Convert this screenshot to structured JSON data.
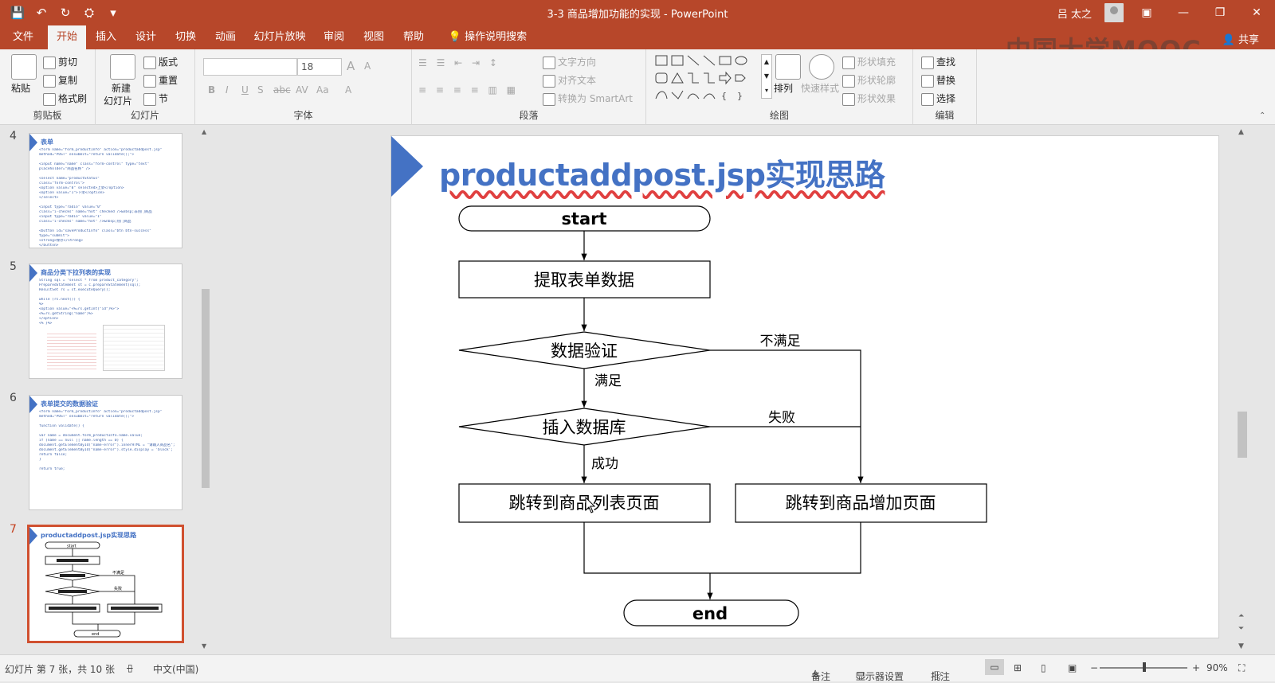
{
  "window": {
    "title": "3-3 商品增加功能的实现  -  PowerPoint",
    "user": "吕 太之",
    "controls": {
      "ribbon_opts": "▣",
      "minimize": "—",
      "restore": "❐",
      "close": "✕"
    }
  },
  "qat": {
    "save": "💾",
    "undo": "↶",
    "redo": "↻",
    "present": "⛭",
    "more": "▾"
  },
  "menu": {
    "tabs": [
      "文件",
      "开始",
      "插入",
      "设计",
      "切换",
      "动画",
      "幻灯片放映",
      "审阅",
      "视图",
      "帮助"
    ],
    "active": "开始",
    "tell_me": "操作说明搜索",
    "share": "共享"
  },
  "watermark": "中国大学MOOC",
  "ribbon": {
    "clipboard": {
      "label": "剪贴板",
      "paste": "粘贴",
      "cut": "剪切",
      "copy": "复制",
      "painter": "格式刷"
    },
    "slides": {
      "label": "幻灯片",
      "new_slide": "新建",
      "new_slide2": "幻灯片",
      "layout": "版式",
      "reset": "重置",
      "section": "节"
    },
    "font": {
      "label": "字体",
      "font_name": "",
      "font_size": "18",
      "b": "B",
      "i": "I",
      "u": "U",
      "s": "S",
      "abc": "abc",
      "av": "AV",
      "aa": "Aa",
      "a": "A",
      "grow": "A",
      "shrink": "A"
    },
    "paragraph": {
      "label": "段落",
      "text_dir": "文字方向",
      "align_text": "对齐文本",
      "smartart": "转换为 SmartArt"
    },
    "drawing": {
      "label": "绘图",
      "arrange": "排列",
      "quick_styles": "快速样式",
      "fill": "形状填充",
      "outline": "形状轮廓",
      "effects": "形状效果"
    },
    "editing": {
      "label": "编辑",
      "find": "查找",
      "replace": "替换",
      "select": "选择"
    }
  },
  "thumbnails": [
    {
      "num": "4",
      "title": "表单",
      "lines": [
        "<form name=\"form_productInfo\" action=\"productaddpost.jsp\"",
        "method=\"POST\" onsubmit=\"return validate();\">",
        "",
        "<input name=\"name\" class=\"form-control\" type=\"text\"",
        "placeholder=\"商品名称\" />",
        "",
        "<select name=\"productStatus\"",
        "class=\"form-control\">",
        "<option value=\"0\" selected>上架</option>",
        "<option value=\"1\">下架</option>",
        "</select>",
        "",
        "<input type=\"radio\" value=\"0\"",
        "class=\"i-checks\" name=\"hot\" checked />&nbsp;非热门商品",
        "<input type=\"radio\" value=\"1\"",
        "class=\"i-checks\" name=\"hot\" />&nbsp;热门商品",
        "",
        "<button id=\"saveProductInfo\" class=\"btn btn-success\"",
        "type=\"submit\">",
        "<strong>保存</strong>",
        "</button>"
      ]
    },
    {
      "num": "5",
      "title": "商品分类下拉列表的实现",
      "lines": [
        "String sql = \"select * from product_category\";",
        "PreparedStatement st = c.prepareStatement(sql);",
        "ResultSet rs = st.executeQuery();",
        "",
        "while (rs.next()) {",
        "%>",
        "<option value=\"<%=rs.getInt(\"id\")%>\">",
        "  <%=rs.getString(\"name\")%>",
        "</option>",
        "<% }%>"
      ]
    },
    {
      "num": "6",
      "title": "表单提交的数据验证",
      "lines": [
        "<form name=\"form_productInfo\" action=\"productaddpost.jsp\"",
        "method=\"POST\" onsubmit=\"return validate();\">",
        "",
        "function validate() {",
        "",
        "var name = document.form_productInfo.name.value;",
        "if (name == null || name.length == 0) {",
        "  document.getElementById(\"name-error\").innerHTML = \"请输入商品名\";",
        "  document.getElementById(\"name-error\").style.display = 'block';",
        "return false;",
        "}",
        "",
        "return true;"
      ]
    },
    {
      "num": "7",
      "title": "productaddpost.jsp实现思路",
      "lines": []
    }
  ],
  "slide": {
    "title": "productaddpost.jsp实现思路",
    "flow": {
      "start": "start",
      "step1": "提取表单数据",
      "decision1": "数据验证",
      "decision2": "插入数据库",
      "success_box": "跳转到商品列表页面",
      "fail_box": "跳转到商品增加页面",
      "end": "end",
      "label_notsat": "不满足",
      "label_sat": "满足",
      "label_fail": "失败",
      "label_success": "成功"
    }
  },
  "mini_flow": {
    "start": "start",
    "end": "end",
    "notsat": "不满足",
    "fail": "失败"
  },
  "status": {
    "slide_info": "幻灯片 第 7 张，共 10 张",
    "lang": "中文(中国)",
    "notes": "备注",
    "display": "显示器设置",
    "comments": "批注",
    "zoom_minus": "−",
    "zoom_plus": "+",
    "zoom": "90%"
  }
}
